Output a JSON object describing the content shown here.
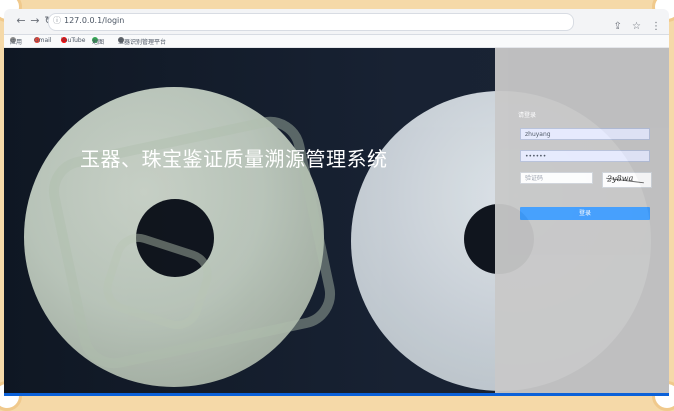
{
  "browser": {
    "url": "127.0.0.1/login",
    "bookmarks": [
      {
        "label": "应用"
      },
      {
        "label": "Gmail"
      },
      {
        "label": "YouTube"
      },
      {
        "label": "地图"
      },
      {
        "label": "玉器识别管理平台"
      }
    ]
  },
  "page": {
    "title": "玉器、珠宝鉴证质量溯源管理系统"
  },
  "login": {
    "heading": "请登录",
    "username_value": "zhuyang",
    "password_value": "••••••",
    "captcha_placeholder": "验证码",
    "captcha_text": "2y8wa",
    "submit_label": "登录"
  },
  "colors": {
    "accent": "#409eff",
    "bottom_bar": "#0b61d9",
    "panel_gray": "#c8c8c8",
    "dark_bg": "#0f1723"
  }
}
